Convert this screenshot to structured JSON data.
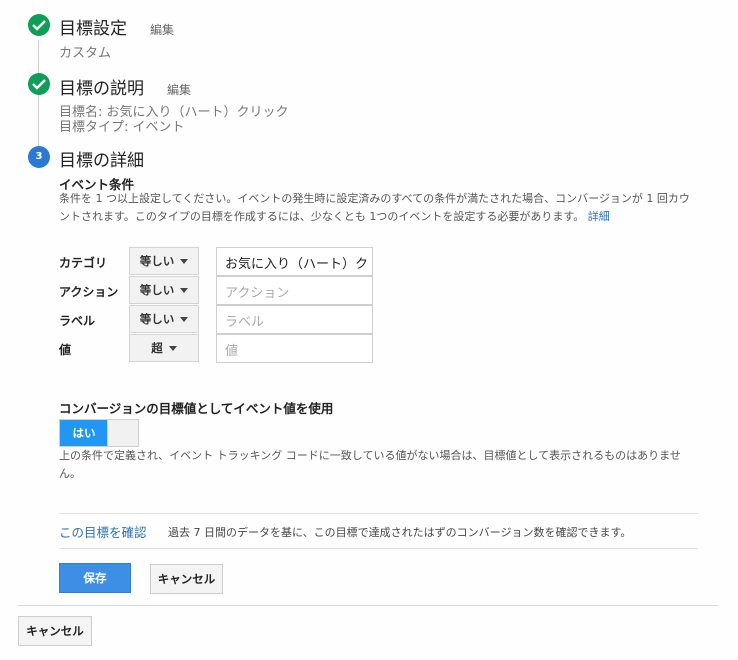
{
  "steps": [
    {
      "title": "目標設定",
      "edit": "編集",
      "summary": [
        "カスタム"
      ]
    },
    {
      "title": "目標の説明",
      "edit": "編集",
      "summary": [
        "目標名: お気に入り（ハート）クリック",
        "目標タイプ: イベント"
      ]
    },
    {
      "number": "3",
      "title": "目標の詳細"
    }
  ],
  "event_conditions": {
    "title": "イベント条件",
    "description_line1": "条件を 1 つ以上設定してください。イベントの発生時に設定済みのすべての条件が満たされた場合、コンバージョンが 1 回カウ",
    "description_line2": "ントされます。このタイプの目標を作成するには、少なくとも 1つのイベントを設定する必要があります。",
    "details_link": "詳細",
    "rows": [
      {
        "label": "カテゴリ",
        "operator": "等しい",
        "value": "お気に入り（ハート）ク",
        "placeholder": ""
      },
      {
        "label": "アクション",
        "operator": "等しい",
        "value": "",
        "placeholder": "アクション"
      },
      {
        "label": "ラベル",
        "operator": "等しい",
        "value": "",
        "placeholder": "ラベル"
      },
      {
        "label": "値",
        "operator": "超",
        "value": "",
        "placeholder": "値"
      }
    ]
  },
  "event_value": {
    "title": "コンバージョンの目標値としてイベント値を使用",
    "toggle_label": "はい",
    "toggle_state": "on",
    "note_line1": "上の条件で定義され、イベント トラッキング コードに一致している値がない場合は、目標値として表示されるものはありませ",
    "note_line2": "ん。"
  },
  "verify": {
    "link": "この目標を確認",
    "text": "過去 7 日間のデータを基に、この目標で達成されたはずのコンバージョン数を確認できます。"
  },
  "buttons": {
    "save": "保存",
    "cancel": "キャンセル",
    "bottom_cancel": "キャンセル"
  },
  "colors": {
    "check": "#0f9d58",
    "step_active": "#2a7ad3",
    "primary": "#3d8fe6",
    "link": "#2a6fb8"
  }
}
